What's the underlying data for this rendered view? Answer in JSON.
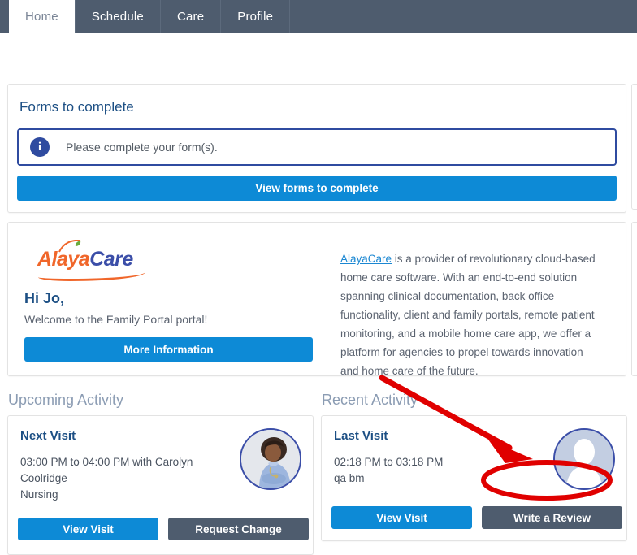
{
  "nav": {
    "tabs": [
      {
        "label": "Home",
        "active": true
      },
      {
        "label": "Schedule",
        "active": false
      },
      {
        "label": "Care",
        "active": false
      },
      {
        "label": "Profile",
        "active": false
      }
    ]
  },
  "forms_card": {
    "title": "Forms to complete",
    "alert_icon": "info-icon",
    "alert_text": "Please complete your form(s).",
    "button_label": "View forms to complete"
  },
  "welcome_card": {
    "logo": {
      "alaya": "Alaya",
      "care": "Care"
    },
    "greeting": "Hi Jo,",
    "subtitle": "Welcome to the Family Portal portal!",
    "button_label": "More Information",
    "description_link": "AlayaCare",
    "description": " is a provider of revolutionary cloud-based home care software. With an end-to-end solution spanning clinical documentation, back office functionality, client and family portals, remote patient monitoring, and a mobile home care app, we offer a platform for agencies to propel towards innovation and home care of the future."
  },
  "upcoming": {
    "section_title": "Upcoming Activity",
    "visit_title": "Next Visit",
    "visit_time": "03:00 PM to 04:00 PM with Carolyn Coolridge",
    "visit_service": "Nursing",
    "primary_button": "View Visit",
    "secondary_button": "Request Change",
    "avatar": "caregiver-photo-avatar"
  },
  "recent": {
    "section_title": "Recent Activity",
    "visit_title": "Last Visit",
    "visit_time": "02:18 PM to 03:18 PM",
    "visit_service": "qa bm",
    "primary_button": "View Visit",
    "secondary_button": "Write a Review",
    "avatar": "default-placeholder-avatar"
  },
  "annotation": {
    "color": "#e00000",
    "target": "Write a Review",
    "shapes": "arrow-and-ellipse-highlight"
  },
  "colors": {
    "navbar": "#4e5c6e",
    "primary_blue": "#0d8ad6",
    "dark_grey_button": "#4e5c6e",
    "heading_blue": "#1c4f84",
    "section_heading": "#8b9cb3",
    "alert_border": "#2f4ba0",
    "logo_orange": "#f0662a",
    "logo_blue": "#3b4ea8",
    "annotation_red": "#e00000"
  }
}
